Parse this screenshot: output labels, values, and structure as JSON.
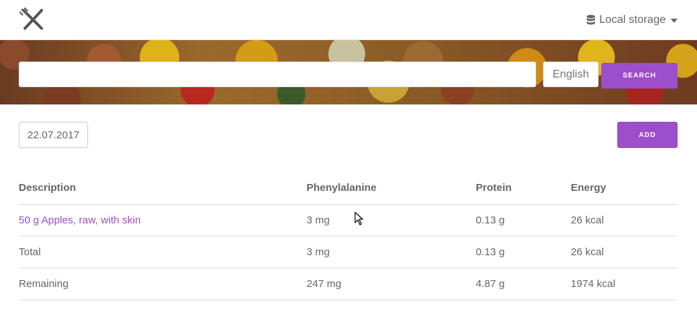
{
  "header": {
    "logo_icon": "utensils-cross-icon",
    "storage_label": "Local storage",
    "storage_icon": "database-icon"
  },
  "search": {
    "value": "",
    "placeholder": "",
    "language": "English",
    "button_label": "SEARCH"
  },
  "toolbar": {
    "date": "22.07.2017",
    "add_label": "ADD"
  },
  "table": {
    "headers": [
      "Description",
      "Phenylalanine",
      "Protein",
      "Energy"
    ],
    "rows": [
      [
        "50 g Apples, raw, with skin",
        "3 mg",
        "0.13 g",
        "26 kcal"
      ],
      [
        "Total",
        "3 mg",
        "0.13 g",
        "26 kcal"
      ],
      [
        "Remaining",
        "247 mg",
        "4.87 g",
        "1974 kcal"
      ]
    ]
  },
  "colors": {
    "accent": "#9c4ecb",
    "text": "#666666",
    "border": "#dddddd"
  }
}
